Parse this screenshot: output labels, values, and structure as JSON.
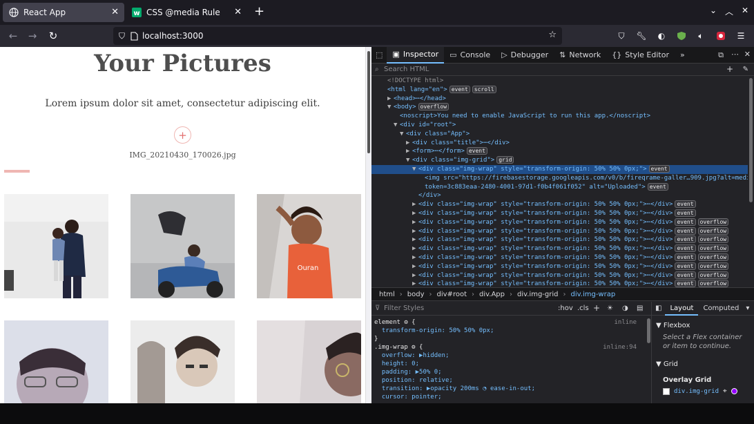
{
  "tabs": [
    {
      "title": "React App",
      "active": true
    },
    {
      "title": "CSS @media Rule",
      "active": false
    }
  ],
  "url": "localhost:3000",
  "page": {
    "heading": "Your Pictures",
    "subtitle": "Lorem ipsum dolor sit amet, consectetur adipiscing elit.",
    "upload_symbol": "+",
    "file_name": "IMG_20210430_170026.jpg",
    "upload_progress": 0.07
  },
  "devtools": {
    "tabs": [
      "Inspector",
      "Console",
      "Debugger",
      "Network",
      "Style Editor"
    ],
    "search_placeholder": "Search HTML",
    "tree": [
      {
        "indent": 0,
        "arrow": "",
        "html": "<!DOCTYPE html>",
        "kind": "doctype"
      },
      {
        "indent": 0,
        "arrow": "",
        "html": "<html lang=\"en\">",
        "badges": [
          "event",
          "scroll"
        ]
      },
      {
        "indent": 1,
        "arrow": "▶",
        "html": "<head>⋯</head>"
      },
      {
        "indent": 1,
        "arrow": "▼",
        "html": "<body>",
        "badges": [
          "overflow"
        ]
      },
      {
        "indent": 2,
        "arrow": "",
        "html": "<noscript>You need to enable JavaScript to run this app.</noscript>"
      },
      {
        "indent": 2,
        "arrow": "▼",
        "html": "<div id=\"root\">"
      },
      {
        "indent": 3,
        "arrow": "▼",
        "html": "<div class=\"App\">"
      },
      {
        "indent": 4,
        "arrow": "▶",
        "html": "<div class=\"title\">⋯</div>"
      },
      {
        "indent": 4,
        "arrow": "▶",
        "html": "<form>⋯</form>",
        "badges": [
          "event"
        ]
      },
      {
        "indent": 4,
        "arrow": "▼",
        "html": "<div class=\"img-grid\">",
        "badges": [
          "grid"
        ]
      },
      {
        "indent": 5,
        "arrow": "▼",
        "html": "<div class=\"img-wrap\" style=\"transform-origin: 50% 50% 0px;\">",
        "badges": [
          "event"
        ],
        "selected": true
      },
      {
        "indent": 6,
        "arrow": "",
        "html": "<img src=\"https://firebasestorage.googleapis.com/v0/b/fireqrame-galler…909.jpg?alt=media&"
      },
      {
        "indent": 6,
        "arrow": "",
        "html": "token=3c883eaa-2480-4001-97d1-f0b4f061f052\" alt=\"Uploaded\">",
        "badges": [
          "event"
        ]
      },
      {
        "indent": 5,
        "arrow": "",
        "html": "</div>"
      },
      {
        "indent": 5,
        "arrow": "▶",
        "html": "<div class=\"img-wrap\" style=\"transform-origin: 50% 50% 0px;\">⋯</div>",
        "badges": [
          "event"
        ]
      },
      {
        "indent": 5,
        "arrow": "▶",
        "html": "<div class=\"img-wrap\" style=\"transform-origin: 50% 50% 0px;\">⋯</div>",
        "badges": [
          "event"
        ]
      },
      {
        "indent": 5,
        "arrow": "▶",
        "html": "<div class=\"img-wrap\" style=\"transform-origin: 50% 50% 0px;\">⋯</div>",
        "badges": [
          "event",
          "overflow"
        ]
      },
      {
        "indent": 5,
        "arrow": "▶",
        "html": "<div class=\"img-wrap\" style=\"transform-origin: 50% 50% 0px;\">⋯</div>",
        "badges": [
          "event",
          "overflow"
        ]
      },
      {
        "indent": 5,
        "arrow": "▶",
        "html": "<div class=\"img-wrap\" style=\"transform-origin: 50% 50% 0px;\">⋯</div>",
        "badges": [
          "event",
          "overflow"
        ]
      },
      {
        "indent": 5,
        "arrow": "▶",
        "html": "<div class=\"img-wrap\" style=\"transform-origin: 50% 50% 0px;\">⋯</div>",
        "badges": [
          "event",
          "overflow"
        ]
      },
      {
        "indent": 5,
        "arrow": "▶",
        "html": "<div class=\"img-wrap\" style=\"transform-origin: 50% 50% 0px;\">⋯</div>",
        "badges": [
          "event",
          "overflow"
        ]
      },
      {
        "indent": 5,
        "arrow": "▶",
        "html": "<div class=\"img-wrap\" style=\"transform-origin: 50% 50% 0px;\">⋯</div>",
        "badges": [
          "event",
          "overflow"
        ]
      },
      {
        "indent": 5,
        "arrow": "▶",
        "html": "<div class=\"img-wrap\" style=\"transform-origin: 50% 50% 0px;\">⋯</div>",
        "badges": [
          "event",
          "overflow"
        ]
      },
      {
        "indent": 5,
        "arrow": "▶",
        "html": "<div class=\"img-wrap\" style=\"transform-origin: 50% 50% 0px;\">⋯</div>",
        "badges": [
          "event",
          "overflow"
        ]
      }
    ],
    "breadcrumbs": [
      "html",
      "body",
      "div#root",
      "div.App",
      "div.img-grid",
      "div.img-wrap"
    ],
    "filter_placeholder": "Filter Styles",
    "rule_tools": [
      ":hov",
      ".cls",
      "+"
    ],
    "rules": [
      {
        "text": "element ⚙ {",
        "source": "inline",
        "kind": "selector"
      },
      {
        "text": "  transform-origin: 50% 50% 0px;",
        "kind": "decl"
      },
      {
        "text": "}",
        "kind": "close"
      },
      {
        "text": ".img-wrap ⚙ {",
        "source": "inline:94",
        "kind": "selector"
      },
      {
        "text": "  overflow: ▶hidden;",
        "kind": "decl"
      },
      {
        "text": "  height: 0;",
        "kind": "decl"
      },
      {
        "text": "  padding: ▶50% 0;",
        "kind": "decl"
      },
      {
        "text": "  position: relative;",
        "kind": "decl"
      },
      {
        "text": "  transition: ▶opacity 200ms ◔ ease-in-out;",
        "kind": "decl"
      },
      {
        "text": "  cursor: pointer;",
        "kind": "decl"
      }
    ],
    "layout_tabs": [
      "Layout",
      "Computed"
    ],
    "flexbox_title": "Flexbox",
    "flexbox_hint": "Select a Flex container or item to continue.",
    "grid_title": "Grid",
    "overlay_grid_title": "Overlay Grid",
    "overlay_item": "div.img-grid"
  },
  "colors": {
    "accent": "#efb6b2",
    "selection": "#204e8a",
    "devtools_bg": "#232327"
  }
}
